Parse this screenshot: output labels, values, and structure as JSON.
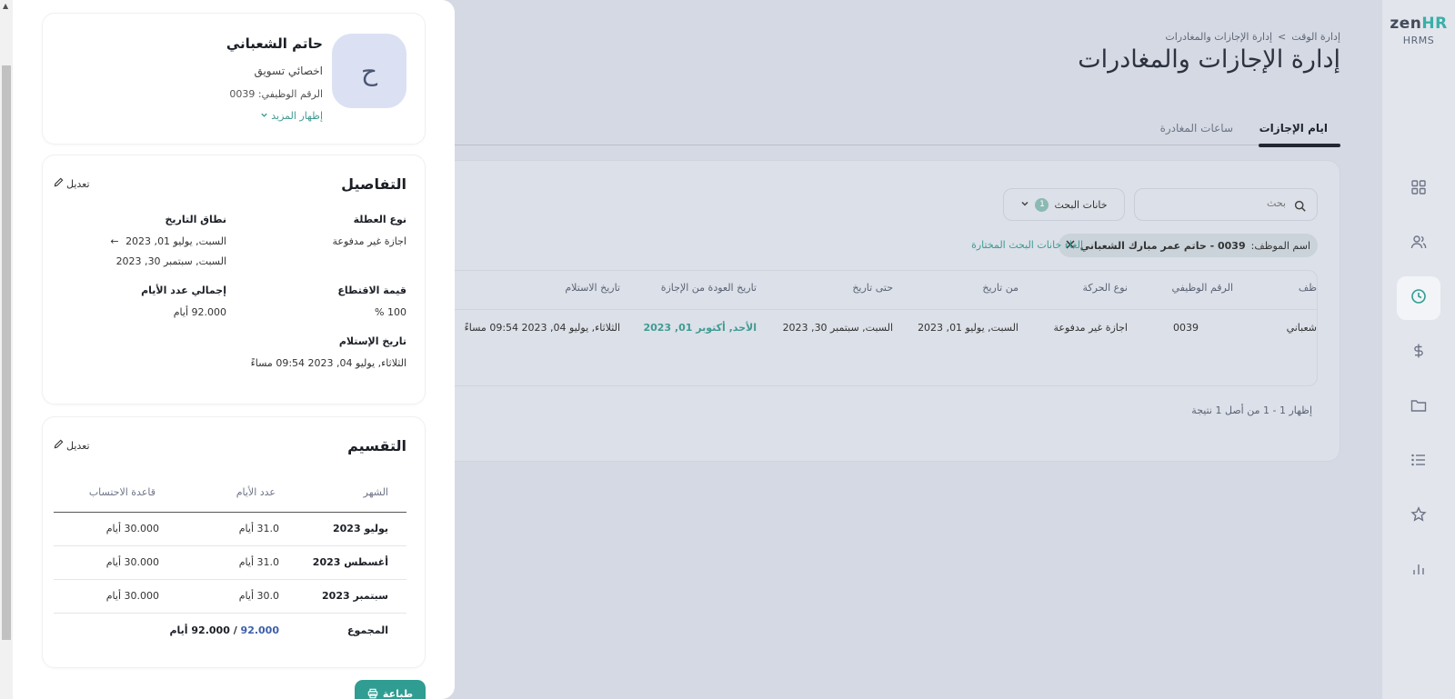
{
  "brand": {
    "logo_zen": "zen",
    "logo_hr": "HR",
    "sub": "HRMS"
  },
  "nav": {
    "items": [
      {
        "name": "dashboard",
        "icon": "grid-icon"
      },
      {
        "name": "employees",
        "icon": "users-icon"
      },
      {
        "name": "time",
        "icon": "clock-icon",
        "active": true
      },
      {
        "name": "payroll",
        "icon": "dollar-icon"
      },
      {
        "name": "documents",
        "icon": "folder-icon"
      },
      {
        "name": "lists",
        "icon": "list-icon"
      },
      {
        "name": "favorites",
        "icon": "star-icon"
      },
      {
        "name": "reports",
        "icon": "bar-chart-icon"
      }
    ]
  },
  "header": {
    "breadcrumb_root": "إدارة الوقت",
    "breadcrumb_sep": ">",
    "breadcrumb_current": "إدارة الإجازات والمغادرات",
    "title": "إدارة الإجازات والمغادرات"
  },
  "tabs": {
    "leave_days": "ايام الإجازات",
    "leave_hours": "ساعات المغادرة"
  },
  "search": {
    "placeholder": "بحث",
    "filter_label": "خانات البحث",
    "filter_count": "1"
  },
  "active_filter": {
    "label": "اسم الموظف:",
    "value": "0039 - حاتم عمر مبارك الشعباني",
    "clear_label": "إلغاء خانات البحث المختارة"
  },
  "table": {
    "headers": {
      "name": "ظف",
      "emp_id": "الرقم الوظيفي",
      "type": "نوع الحركة",
      "from": "من تاريخ",
      "to": "حتى تاريخ",
      "return": "تاريخ العودة من الإجازة",
      "received": "تاريخ الاستلام"
    },
    "row": {
      "name": "شعباني",
      "emp_id": "0039",
      "type": "اجازة غير مدفوعة",
      "from": "السبت, يوليو 01, 2023",
      "to": "السبت, سبتمبر 30, 2023",
      "return": "الأحد, أكتوبر 01, 2023",
      "received": "الثلاثاء, يوليو 04, 2023 09:54 مساءً"
    },
    "footer": "إظهار 1 - 1 من أصل 1 نتيجة"
  },
  "drawer": {
    "avatar_letter": "ح",
    "name": "حاتم الشعباني",
    "job_title": "اخصائي تسويق",
    "emp_id_text": "الرقم الوظيفي: 0039",
    "show_more": "إظهار المزيد",
    "details": {
      "title": "التفاصيل",
      "edit": "تعديل",
      "leave_type_label": "نوع العطلة",
      "leave_type_value": "اجازة غير مدفوعة",
      "date_range_label": "نطاق التاريخ",
      "date_range_from": "السبت, يوليو 01, 2023",
      "date_range_to": "السبت, سبتمبر 30, 2023",
      "deduction_label": "قيمة الاقتطاع",
      "deduction_value": "100 %",
      "total_days_label": "إجمالي عدد الأيام",
      "total_days_value": "92.000 أيام",
      "received_label": "تاريخ الإستلام",
      "received_value": "الثلاثاء, يوليو 04, 2023 09:54 مساءً"
    },
    "split": {
      "title": "التقسيم",
      "edit": "تعديل",
      "headers": {
        "month": "الشهر",
        "days": "عدد الأيام",
        "basis": "قاعدة الاحتساب"
      },
      "rows": [
        {
          "month": "يوليو 2023",
          "days": "31.0 أيام",
          "basis": "30.000 أيام"
        },
        {
          "month": "أغسطس 2023",
          "days": "31.0 أيام",
          "basis": "30.000 أيام"
        },
        {
          "month": "سبتمبر 2023",
          "days": "30.0 أيام",
          "basis": "30.000 أيام"
        }
      ],
      "total_label": "المجموع",
      "total_value": "92.000",
      "total_rest": " / 92.000 أيام"
    },
    "print": "طباعة"
  },
  "colors": {
    "accent": "#2f9d92",
    "link": "#3f9b93",
    "nav_bg": "#e2e5ec",
    "overlay_bg": "#d5d9e3"
  }
}
